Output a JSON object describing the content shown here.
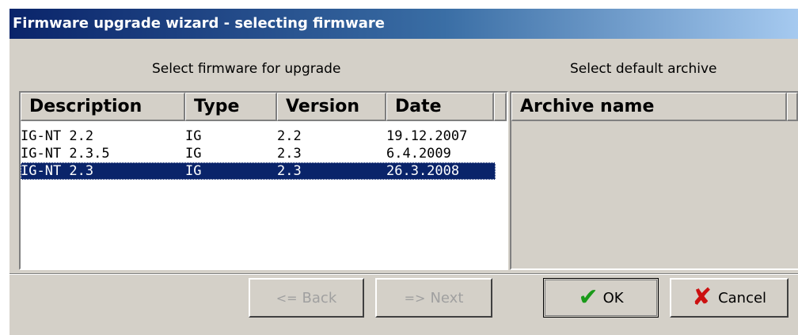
{
  "window": {
    "title": "Firmware upgrade wizard - selecting firmware"
  },
  "firmware_section": {
    "label": "Select firmware for upgrade",
    "columns": [
      "Description",
      "Type",
      "Version",
      "Date"
    ],
    "rows": [
      {
        "description": "IG-NT 2.2",
        "type": "IG",
        "version": "2.2",
        "date": "19.12.2007",
        "selected": false
      },
      {
        "description": "IG-NT 2.3.5",
        "type": "IG",
        "version": "2.3",
        "date": "6.4.2009",
        "selected": false
      },
      {
        "description": "IG-NT 2.3",
        "type": "IG",
        "version": "2.3",
        "date": "26.3.2008",
        "selected": true
      }
    ]
  },
  "archive_section": {
    "label": "Select default archive",
    "columns": [
      "Archive name"
    ],
    "rows": []
  },
  "buttons": {
    "back": {
      "label": "Back",
      "icon": "left-arrow-icon",
      "enabled": false
    },
    "next": {
      "label": "Next",
      "icon": "right-arrow-icon",
      "enabled": false
    },
    "ok": {
      "label": "OK",
      "icon": "checkmark-icon",
      "enabled": true
    },
    "cancel": {
      "label": "Cancel",
      "icon": "x-mark-icon",
      "enabled": true
    }
  },
  "colors": {
    "title_start": "#0a246a",
    "title_end": "#a6caf0",
    "selection": "#0a246a",
    "face": "#d4d0c8",
    "ok_icon": "#1a9a1a",
    "cancel_icon": "#cc1010"
  }
}
